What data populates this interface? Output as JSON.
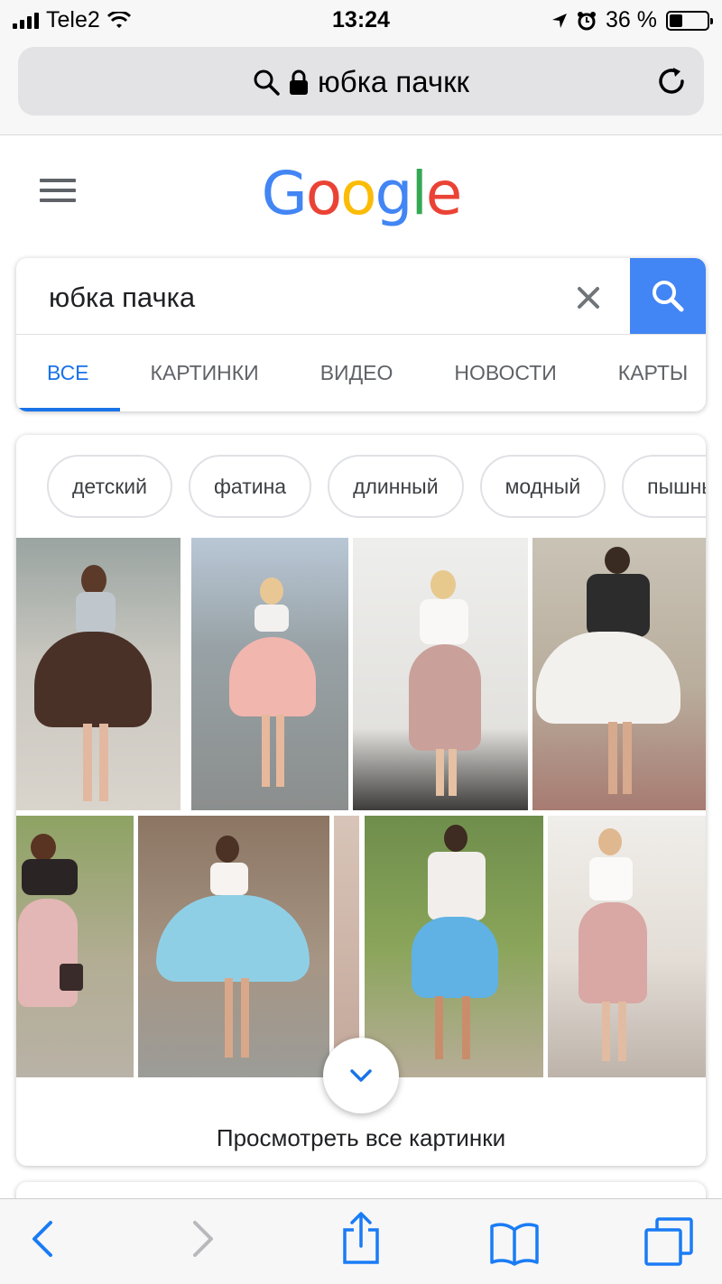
{
  "status_bar": {
    "carrier": "Tele2",
    "time": "13:24",
    "battery_percent": "36 %",
    "battery_level": 0.36
  },
  "browser": {
    "url_text": "юбка пачкк",
    "icons": [
      "search-icon",
      "lock-icon",
      "reload-icon"
    ]
  },
  "google": {
    "logo": [
      {
        "ch": "G",
        "color": "#4285f4"
      },
      {
        "ch": "o",
        "color": "#ea4335"
      },
      {
        "ch": "o",
        "color": "#fbbc05"
      },
      {
        "ch": "g",
        "color": "#4285f4"
      },
      {
        "ch": "l",
        "color": "#34a853"
      },
      {
        "ch": "e",
        "color": "#ea4335"
      }
    ]
  },
  "search": {
    "query": "юбка пачка",
    "tabs": [
      "ВСЕ",
      "КАРТИНКИ",
      "ВИДЕО",
      "НОВОСТИ",
      "КАРТЫ"
    ],
    "active_tab": "ВСЕ"
  },
  "images": {
    "chips": [
      "детский",
      "фатина",
      "длинный",
      "модный",
      "пышный"
    ],
    "more_label": "Просмотреть все картинки"
  },
  "colors": {
    "accent": "#1a73e8",
    "search_button": "#4285f4"
  },
  "toolbar": {
    "icons": [
      "back-icon",
      "forward-icon",
      "share-icon",
      "bookmarks-icon",
      "tabs-icon"
    ]
  }
}
